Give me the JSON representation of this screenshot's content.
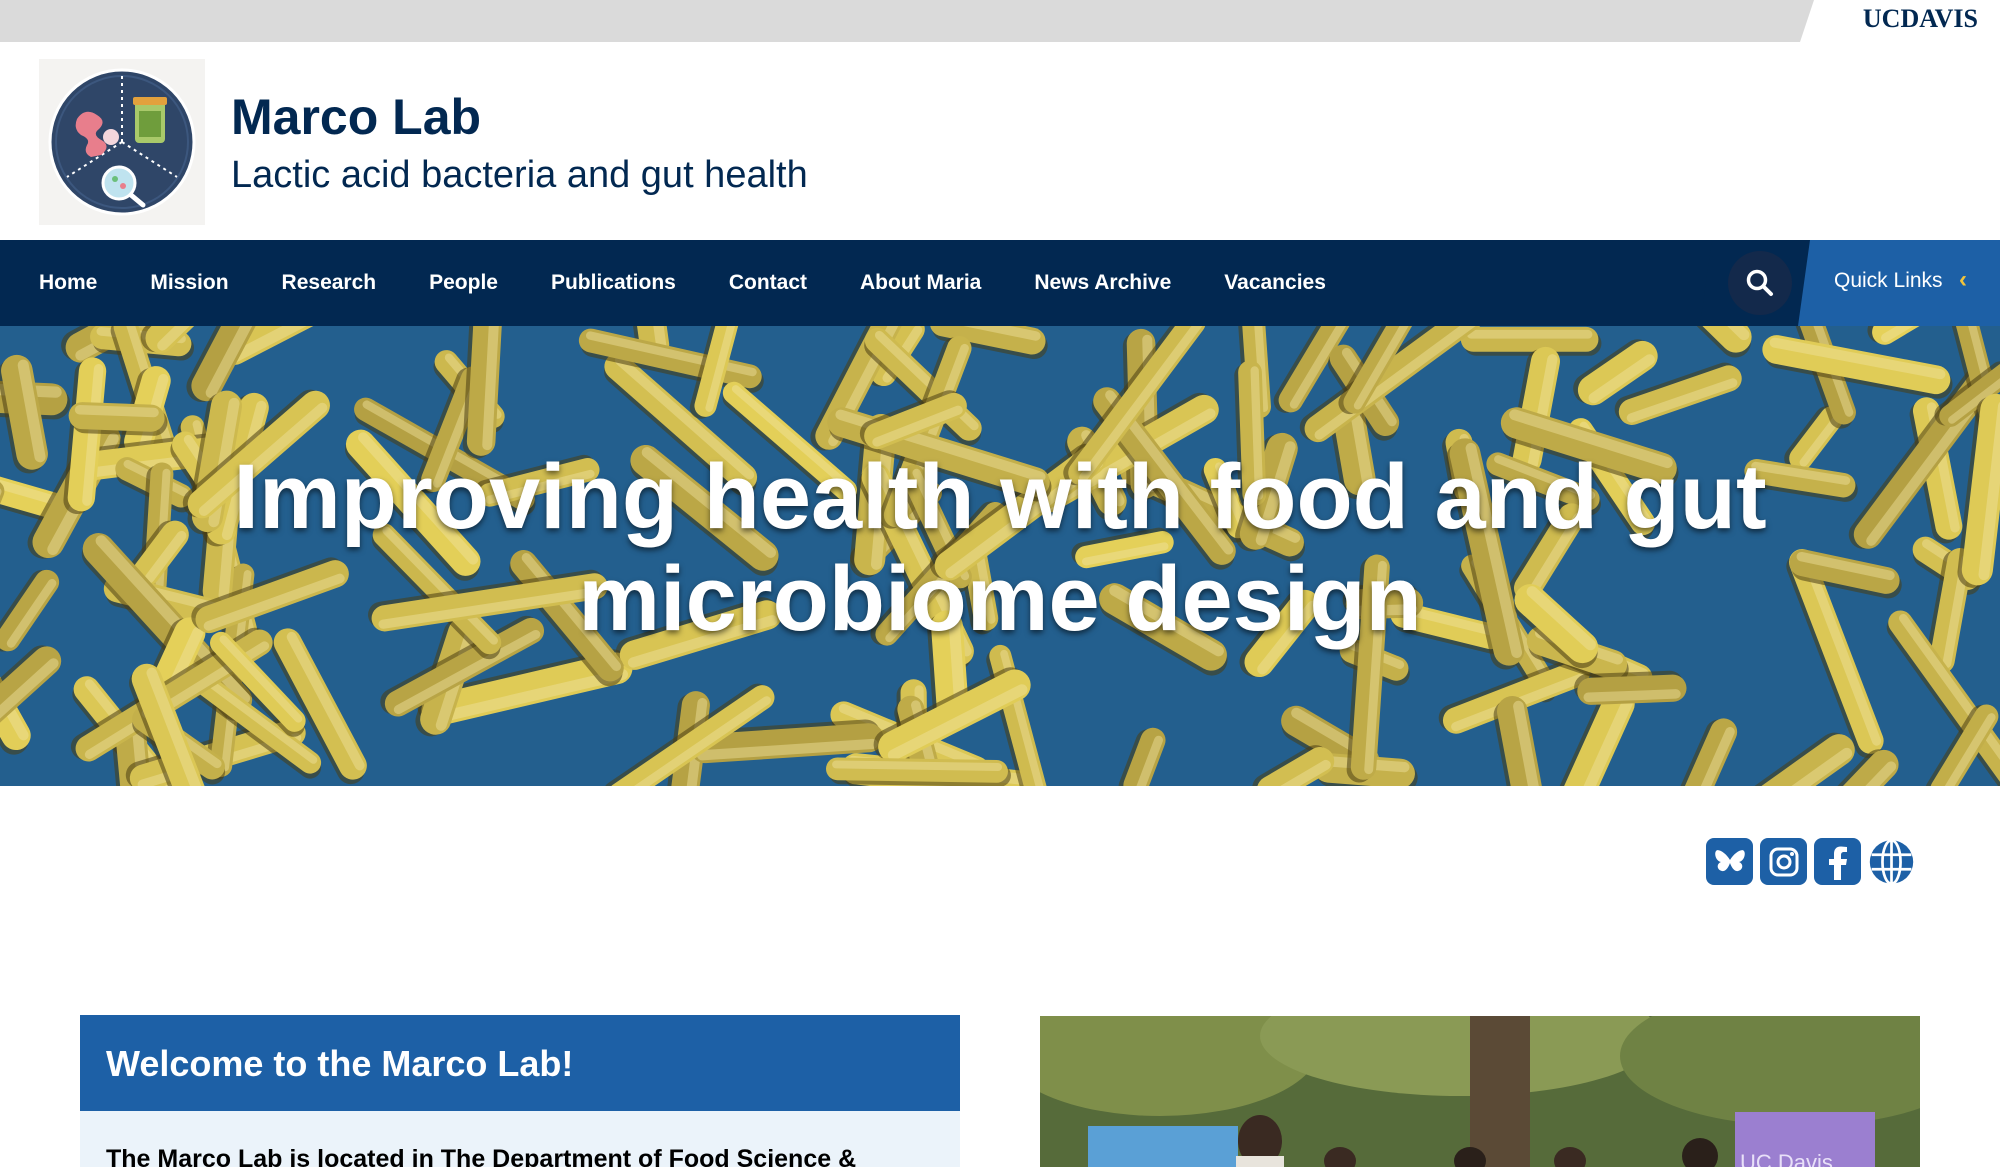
{
  "top_bar": {
    "brand": "UCDAVIS"
  },
  "header": {
    "title": "Marco Lab",
    "slogan": "Lactic acid bacteria and gut health"
  },
  "nav": {
    "items": [
      {
        "label": "Home"
      },
      {
        "label": "Mission"
      },
      {
        "label": "Research"
      },
      {
        "label": "People"
      },
      {
        "label": "Publications"
      },
      {
        "label": "Contact"
      },
      {
        "label": "About Maria"
      },
      {
        "label": "News Archive"
      },
      {
        "label": "Vacancies"
      }
    ],
    "quick_links_label": "Quick Links",
    "search_icon": "search-icon",
    "quick_links_icon": "chevron-left-icon"
  },
  "hero": {
    "title": "Improving health with food and gut microbiome design"
  },
  "social": {
    "icons": [
      "bluesky-icon",
      "instagram-icon",
      "facebook-icon",
      "globe-icon"
    ]
  },
  "welcome": {
    "title": "Welcome to the Marco Lab!",
    "body": "The Marco Lab is located in The Department of Food Science &"
  },
  "photo": {
    "sign_text": "UC Davis"
  },
  "colors": {
    "navy": "#022851",
    "blue": "#1d60a6",
    "gold": "#f2c43b",
    "light_blue_bg": "#ebf3fa",
    "gray_bar": "#dadada"
  }
}
